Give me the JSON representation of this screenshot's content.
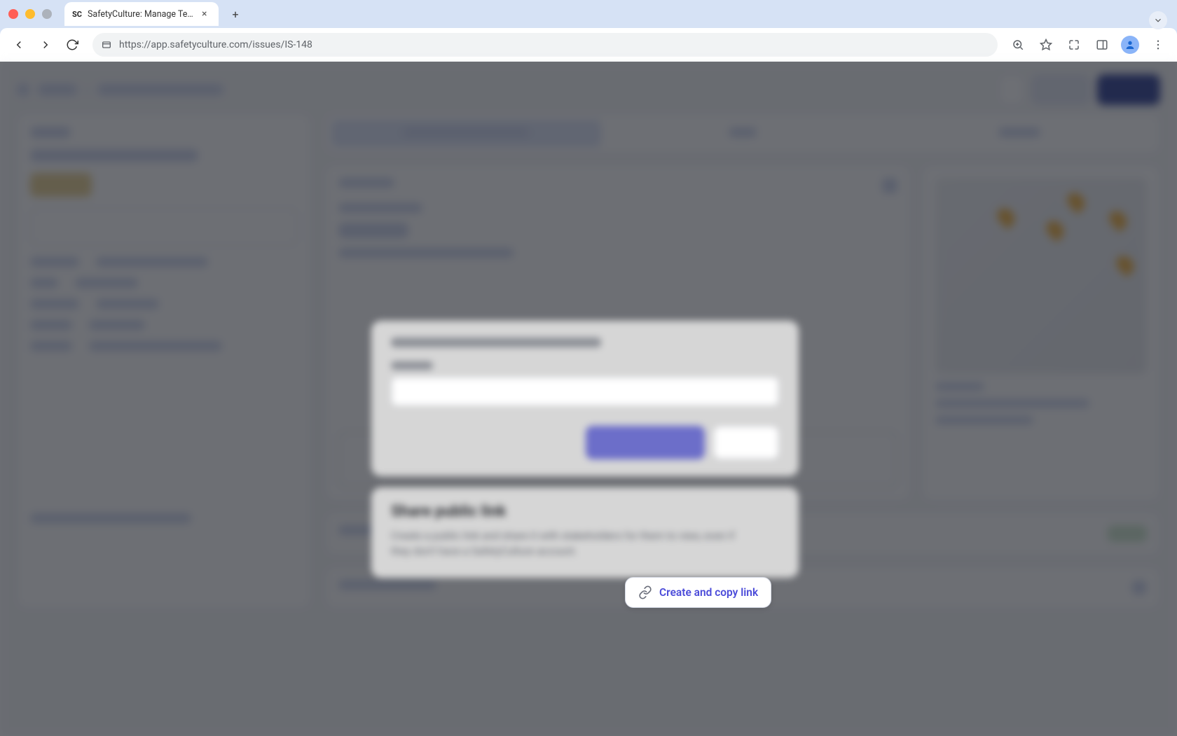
{
  "browser": {
    "tab_title": "SafetyCulture: Manage Teams and...",
    "url": "https://app.safetyculture.com/issues/IS-148"
  },
  "share_panel": {
    "title": "Share public link",
    "description": "Create a public link and share it with stakeholders for them to view, even if they don't have a SafetyCulture account.",
    "button_label": "Create and copy link"
  }
}
